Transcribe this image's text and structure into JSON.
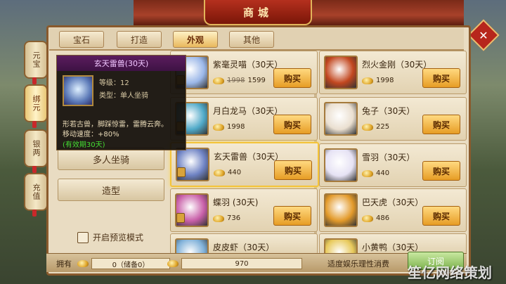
{
  "header": {
    "title": "商城"
  },
  "side_tabs": [
    {
      "label": "元宝"
    },
    {
      "label": "绑元"
    },
    {
      "label": "银两"
    },
    {
      "label": "充值"
    }
  ],
  "tabs": [
    {
      "label": "宝石"
    },
    {
      "label": "打造"
    },
    {
      "label": "外观"
    },
    {
      "label": "其他"
    }
  ],
  "left_menu": [
    {
      "label": "多人坐骑"
    },
    {
      "label": "造型"
    }
  ],
  "preview_toggle": {
    "label": "开启预览模式"
  },
  "tooltip": {
    "title": "玄天雷兽(30天)",
    "level": "等级：12",
    "type": "类型：单人坐骑",
    "desc": "形若古兽，脚踩惊雷，雷腾云奔。",
    "speed": "移动速度：+80%",
    "valid": "(有效期30天)"
  },
  "items": [
    {
      "name": "紫毫灵喵（30天）",
      "old_price": "1998",
      "price": "1599",
      "buy": "购买",
      "icon_color": "#9bb7e8"
    },
    {
      "name": "烈火金刚（30天）",
      "price": "1998",
      "buy": "购买",
      "icon_color": "#c2471f"
    },
    {
      "name": "月白龙马（30天）",
      "price": "1998",
      "buy": "购买",
      "icon_color": "#4fa9c8"
    },
    {
      "name": "兔子（30天）",
      "price": "225",
      "buy": "购买",
      "icon_color": "#eadfd0"
    },
    {
      "name": "玄天雷兽（30天）",
      "price": "440",
      "buy": "购买",
      "icon_color": "#6f83c4"
    },
    {
      "name": "雪羽（30天）",
      "price": "440",
      "buy": "购买",
      "icon_color": "#e6e2f4"
    },
    {
      "name": "蝶羽 (30天)",
      "price": "736",
      "buy": "购买",
      "icon_color": "#c85fa8"
    },
    {
      "name": "巴天虎（30天）",
      "price": "486",
      "buy": "购买",
      "icon_color": "#e39a2a"
    },
    {
      "name": "皮皮虾（30天）",
      "price": "",
      "buy": "",
      "icon_color": "#7fb0d8"
    },
    {
      "name": "小黄鸭（30天）",
      "price": "",
      "buy": "",
      "icon_color": "#e8c95a"
    }
  ],
  "bottom": {
    "own_label": "拥有",
    "ingot_value": "0（储备0）",
    "bound_value": "970",
    "notice": "适度娱乐理性消费",
    "recharge": "订阅"
  },
  "watermark": "笙亿网络策划"
}
